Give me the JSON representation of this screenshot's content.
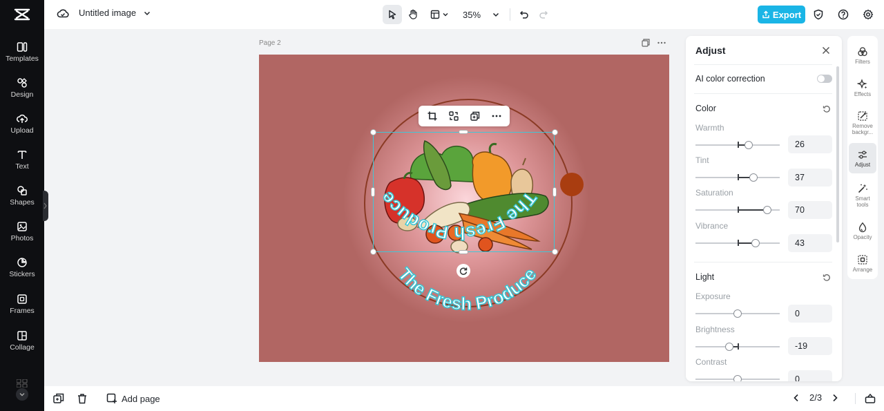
{
  "sidebar": {
    "items": [
      {
        "label": "Templates",
        "icon": "templates-icon"
      },
      {
        "label": "Design",
        "icon": "design-icon"
      },
      {
        "label": "Upload",
        "icon": "upload-icon"
      },
      {
        "label": "Text",
        "icon": "text-icon"
      },
      {
        "label": "Shapes",
        "icon": "shapes-icon"
      },
      {
        "label": "Photos",
        "icon": "photos-icon"
      },
      {
        "label": "Stickers",
        "icon": "stickers-icon"
      },
      {
        "label": "Frames",
        "icon": "frames-icon"
      },
      {
        "label": "Collage",
        "icon": "collage-icon"
      }
    ]
  },
  "topbar": {
    "doc_title": "Untitled image",
    "zoom": "35%",
    "export_label": "Export"
  },
  "canvas": {
    "page_label": "Page 2",
    "background_color": "#b16663",
    "artwork": {
      "text_top": "The Fresh Produce",
      "text_bottom": "The Fresh Produce"
    }
  },
  "adjust_panel": {
    "title": "Adjust",
    "ai_label": "AI color correction",
    "ai_enabled": false,
    "color_section": "Color",
    "light_section": "Light",
    "color_controls": [
      {
        "label": "Warmth",
        "value": "26"
      },
      {
        "label": "Tint",
        "value": "37"
      },
      {
        "label": "Saturation",
        "value": "70"
      },
      {
        "label": "Vibrance",
        "value": "43"
      }
    ],
    "light_controls": [
      {
        "label": "Exposure",
        "value": "0"
      },
      {
        "label": "Brightness",
        "value": "-19"
      },
      {
        "label": "Contrast",
        "value": "0"
      }
    ]
  },
  "right_rail": {
    "items": [
      {
        "label": "Filters"
      },
      {
        "label": "Effects"
      },
      {
        "label": "Remove backgr..."
      },
      {
        "label": "Adjust",
        "active": true
      },
      {
        "label": "Smart tools"
      },
      {
        "label": "Opacity"
      },
      {
        "label": "Arrange"
      }
    ]
  },
  "bottombar": {
    "add_page_label": "Add page",
    "page_indicator": "2/3"
  },
  "colors": {
    "accent": "#1ab5e6",
    "selection": "#3ec7d8",
    "sidebar_bg": "#0e0f12"
  }
}
